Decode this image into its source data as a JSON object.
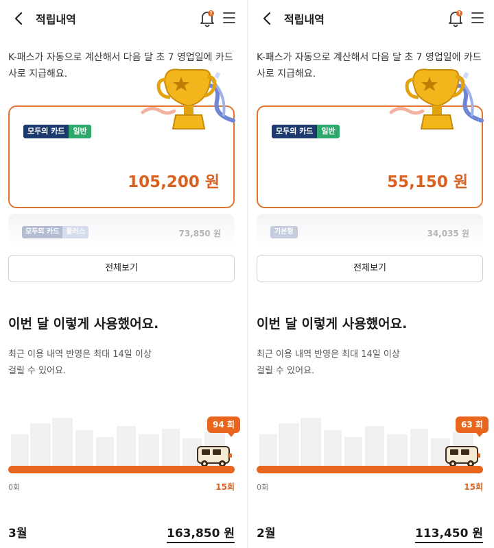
{
  "colors": {
    "accent": "#e8651e",
    "brand_dark": "#1d3a6e",
    "brand_green": "#2fa86b"
  },
  "panels": [
    {
      "header": {
        "title": "적립내역",
        "notification_badge": "1"
      },
      "intro": "K-패스가 자동으로 계산해서 다음 달 초 7 영업일에 카드사로 지급해요.",
      "main_card": {
        "tag_primary": "모두의 카드",
        "tag_secondary": "일반",
        "amount": "105,200 원"
      },
      "sub_card": {
        "tag_primary": "모두의 카드",
        "tag_secondary": "플러스",
        "amount": "73,850 원"
      },
      "view_all": "전체보기",
      "usage": {
        "title": "이번 달 이렇게 사용했어요.",
        "desc_line1": "최근 이용 내역 반영은 최대 14일 이상",
        "desc_line2": "걸릴 수 있어요.",
        "count": "94 회",
        "min_label": "0회",
        "max_label": "15회"
      },
      "month": {
        "label": "3월",
        "total": "163,850 원"
      }
    },
    {
      "header": {
        "title": "적립내역",
        "notification_badge": "1"
      },
      "intro": "K-패스가 자동으로 계산해서 다음 달 초 7 영업일에 카드사로 지급해요.",
      "main_card": {
        "tag_primary": "모두의 카드",
        "tag_secondary": "일반",
        "amount": "55,150 원"
      },
      "sub_card": {
        "tag_single": "기본형",
        "amount": "34,035 원"
      },
      "view_all": "전체보기",
      "usage": {
        "title": "이번 달 이렇게 사용했어요.",
        "desc_line1": "최근 이용 내역 반영은 최대 14일 이상",
        "desc_line2": "걸릴 수 있어요.",
        "count": "63 회",
        "min_label": "0회",
        "max_label": "15회"
      },
      "month": {
        "label": "2월",
        "total": "113,450 원"
      }
    }
  ],
  "icons": [
    "back-arrow-icon",
    "bell-icon",
    "menu-icon",
    "trophy-icon",
    "bus-icon"
  ]
}
